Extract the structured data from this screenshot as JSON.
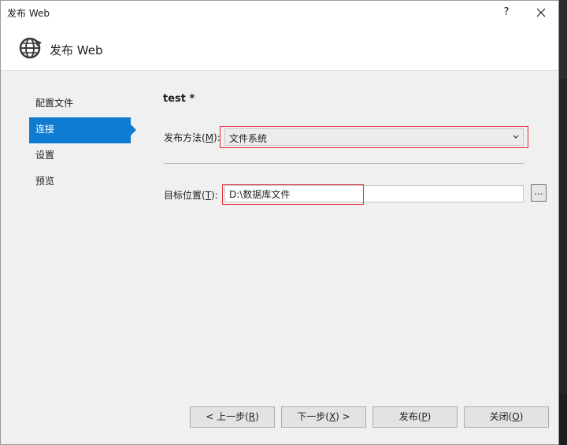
{
  "window": {
    "title": "发布 Web"
  },
  "titlebar": {
    "help": "?",
    "close_icon": "close-icon"
  },
  "header": {
    "title": "发布 Web",
    "icon": "globe-publish-icon"
  },
  "nav": {
    "items": [
      {
        "label": "配置文件",
        "active": false
      },
      {
        "label": "连接",
        "active": true
      },
      {
        "label": "设置",
        "active": false
      },
      {
        "label": "预览",
        "active": false
      }
    ]
  },
  "main": {
    "profile_name": "test *",
    "method": {
      "label_prefix": "发布方法(",
      "mnemonic": "M",
      "label_suffix": "):",
      "value": "文件系统"
    },
    "target": {
      "label_prefix": "目标位置(",
      "mnemonic": "T",
      "label_suffix": "):",
      "value": "D:\\数据库文件",
      "browse": "..."
    }
  },
  "buttons": {
    "prev": {
      "prefix": "< 上一步(",
      "mnemonic": "R",
      "suffix": ")"
    },
    "next": {
      "prefix": "下一步(",
      "mnemonic": "X",
      "suffix": ") >"
    },
    "publish": {
      "prefix": "发布(",
      "mnemonic": "P",
      "suffix": ")"
    },
    "close": {
      "prefix": "关闭(",
      "mnemonic": "O",
      "suffix": ")"
    }
  },
  "colors": {
    "accent": "#0f7bd1",
    "highlight": "#e0303a"
  }
}
